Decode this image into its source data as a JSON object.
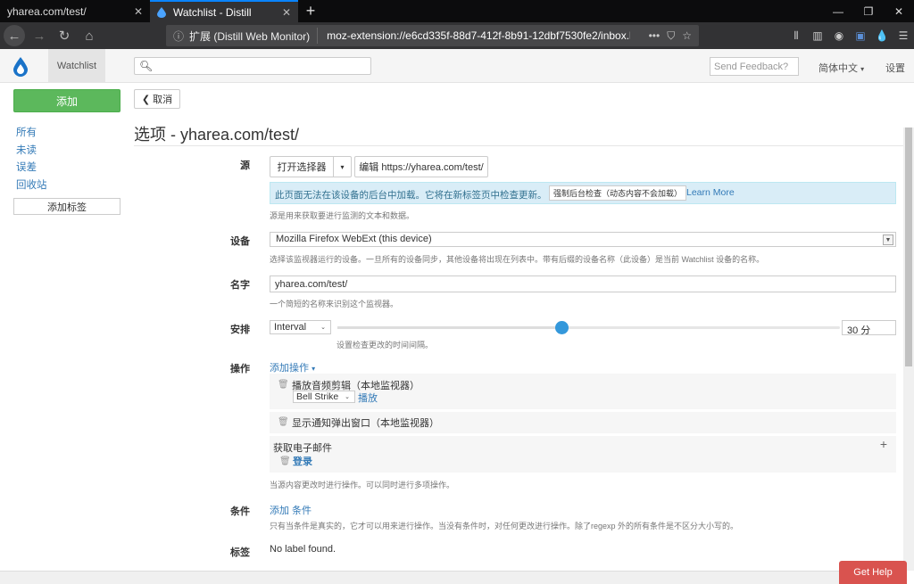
{
  "browser": {
    "tabs": [
      {
        "title": "yharea.com/test/",
        "active": false
      },
      {
        "title": "Watchlist - Distill",
        "active": true
      }
    ],
    "new_tab": "+",
    "window_controls": [
      "—",
      "❐",
      "✕"
    ],
    "url_ext_label": "扩展 (Distill Web Monitor)",
    "url": "moz-extension://e6cd335f-88d7-412f-8b91-12dbf7530fe2/inbox.ht"
  },
  "header": {
    "nav_watchlist": "Watchlist",
    "search_placeholder": "",
    "feedback_placeholder": "Send Feedback?",
    "language": "简体中文",
    "settings": "设置"
  },
  "sidebar": {
    "add_button": "添加",
    "links": [
      "所有",
      "未读",
      "误差",
      "回收站"
    ],
    "add_label_button": "添加标签"
  },
  "main": {
    "cancel": "取消",
    "title": "选项 - yharea.com/test/",
    "source": {
      "label": "源",
      "open_selector": "打开选择器",
      "edit_button": "编辑 https://yharea.com/test/",
      "info_message": "此页面无法在该设备的后台中加载。它将在新标签页中检查更新。",
      "force_button": "强制后台检查（动态内容不会加载）",
      "learn_more": "Learn More",
      "help": "源是用来获取要进行监测的文本和数据。"
    },
    "device": {
      "label": "设备",
      "value": "Mozilla Firefox WebExt (this device)",
      "help": "选择该监视器运行的设备。一旦所有的设备同步，其他设备将出现在列表中。带有后缀的设备名称（此设备）是当前 Watchlist 设备的名称。"
    },
    "name": {
      "label": "名字",
      "value": "yharea.com/test/",
      "help": "一个简短的名称来识别这个监视器。"
    },
    "schedule": {
      "label": "安排",
      "type": "Interval",
      "slider_fraction": 0.445,
      "value": "30 分",
      "help": "设置检查更改的时间间隔。"
    },
    "actions": {
      "label": "操作",
      "add_action": "添加操作",
      "items": [
        {
          "title": "播放音频剪辑（本地监视器）",
          "sound": "Bell Strike",
          "play": "播放"
        },
        {
          "title": "显示通知弹出窗口（本地监视器）"
        }
      ],
      "email_title": "获取电子邮件",
      "login": "登录",
      "help": "当源内容更改时进行操作。可以同时进行多项操作。"
    },
    "conditions": {
      "label": "条件",
      "add_condition": "添加 条件",
      "help": "只有当条件是真实的，它才可以用来进行操作。当没有条件时，对任何更改进行操作。除了regexp 外的所有条件是不区分大小写的。"
    },
    "labels": {
      "label": "标签",
      "value": "No label found."
    }
  },
  "get_help": "Get Help",
  "colors": {
    "brand": "#1a73c8",
    "add_button": "#5cb85c",
    "get_help": "#d9534f",
    "slider_knob": "#3498db",
    "info_bg": "#d9edf7"
  }
}
